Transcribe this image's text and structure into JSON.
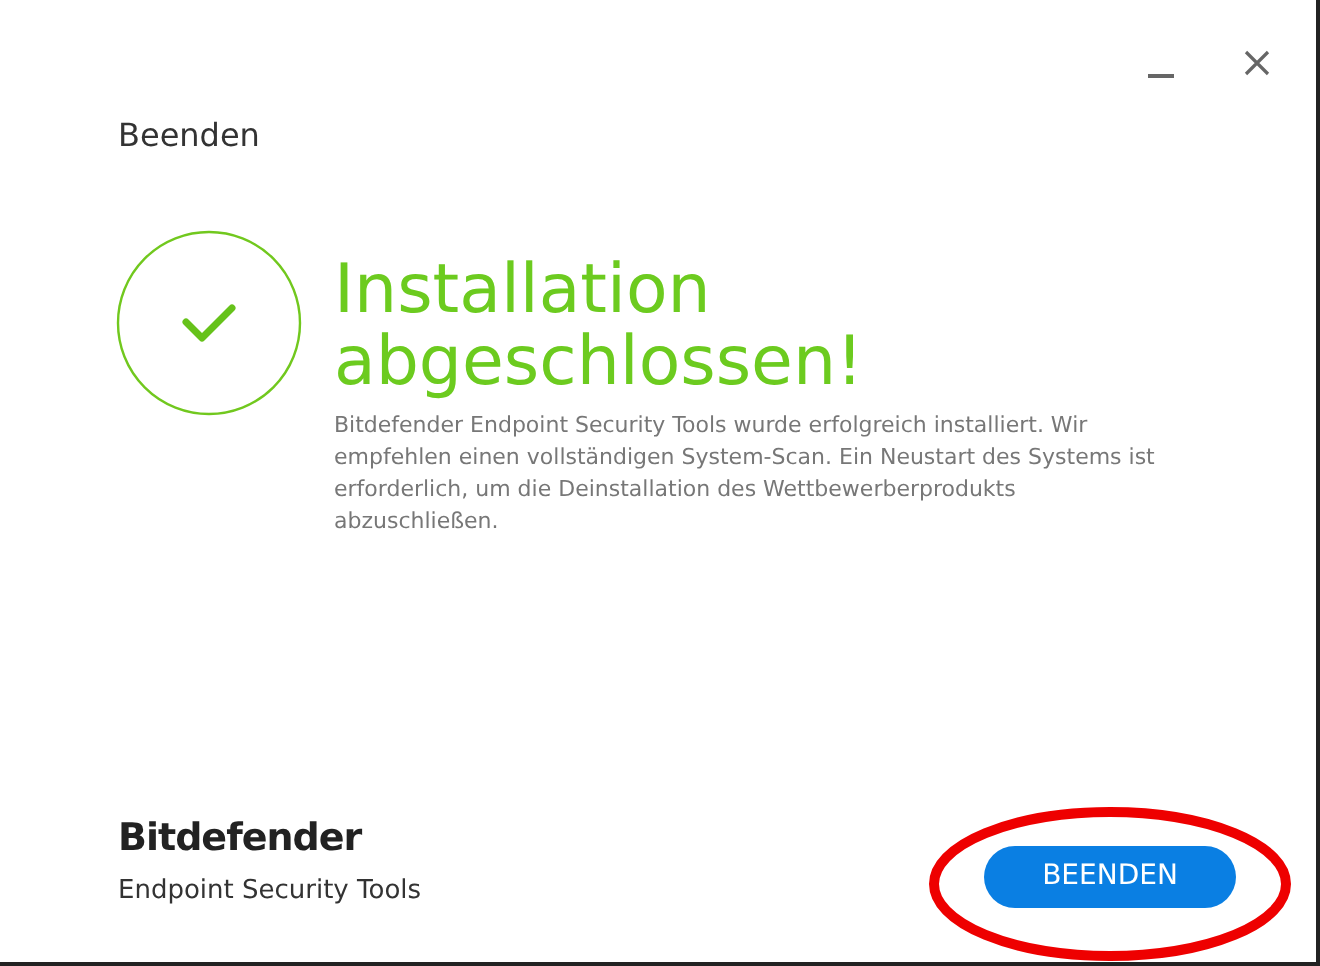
{
  "window": {
    "heading": "Beenden"
  },
  "result": {
    "success": true,
    "title_lines": [
      "Installation",
      "abgeschlossen!"
    ],
    "message": "Bitdefender Endpoint Security Tools wurde erfolgreich installiert. Wir empfehlen einen vollständigen System-Scan. Ein Neustart des Systems ist erforderlich, um die Deinstallation des Wettbewerberprodukts abzuschließen."
  },
  "brand": {
    "name": "Bitdefender",
    "product": "Endpoint Security Tools"
  },
  "buttons": [
    {
      "label": "BEENDEN",
      "highlighted": true
    }
  ]
}
